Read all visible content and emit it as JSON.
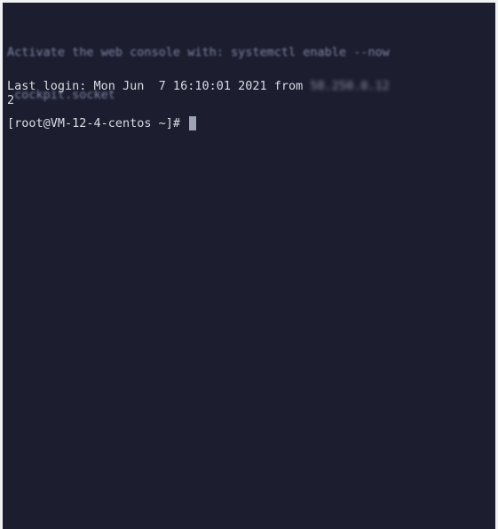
{
  "terminal": {
    "motd": {
      "line1": "Activate the web console with: systemctl enable --now",
      "line2": " cockpit.socket"
    },
    "login": {
      "text": "Last login: Mon Jun  7 16:10:01 2021 from ",
      "ip": "58.250.0.12",
      "wrap": "2"
    },
    "prompt": {
      "text": "[root@VM-12-4-centos ~]# "
    },
    "background": "#1c1d2e",
    "foreground": "#dadce6"
  }
}
